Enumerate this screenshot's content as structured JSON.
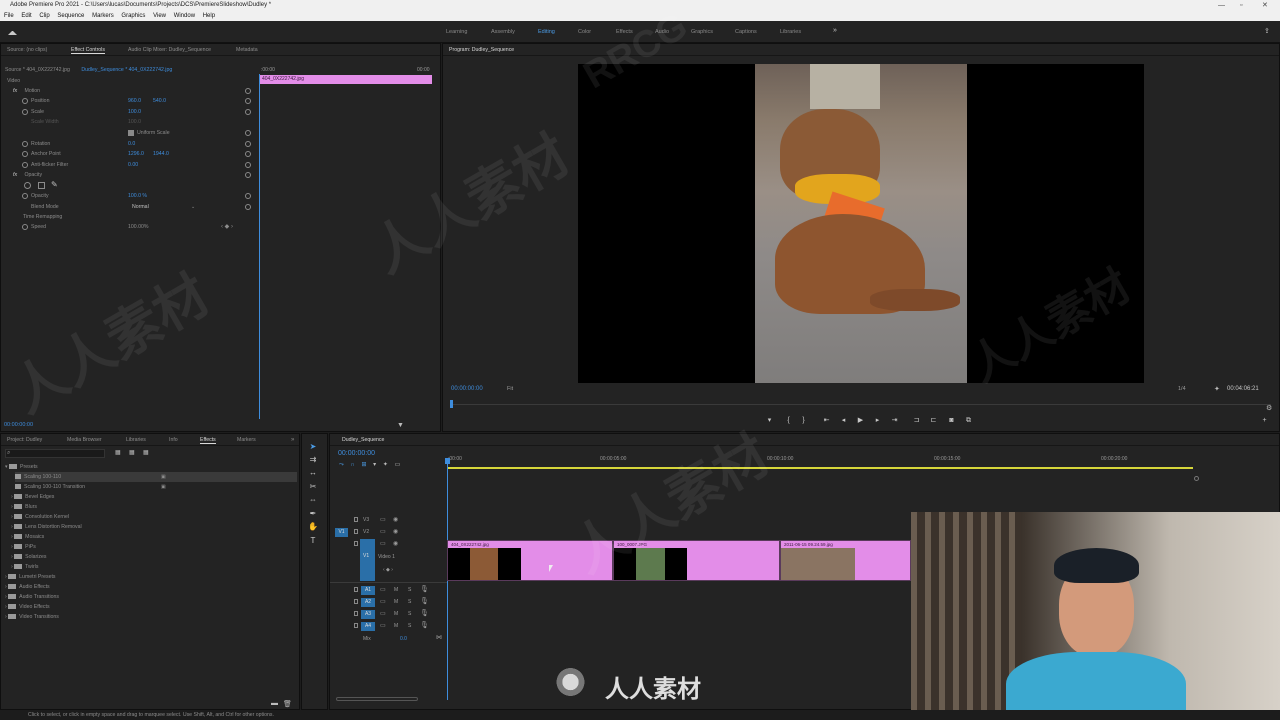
{
  "window": {
    "title": "Adobe Premiere Pro 2021 - C:\\Users\\lucas\\Documents\\Projects\\DCS\\PremiereSlideshow\\Dudley *"
  },
  "menu": [
    "File",
    "Edit",
    "Clip",
    "Sequence",
    "Markers",
    "Graphics",
    "View",
    "Window",
    "Help"
  ],
  "workspaces": [
    "Learning",
    "Assembly",
    "Editing",
    "Color",
    "Effects",
    "Audio",
    "Graphics",
    "Captions",
    "Libraries"
  ],
  "source_panel": {
    "tabs": [
      "Source: (no clips)",
      "Effect Controls",
      "Audio Clip Mixer: Dudley_Sequence",
      "Metadata"
    ],
    "clip_path": "Source * 404_0X222742.jpg",
    "sequence_path": "Dudley_Sequence * 404_0X222742.jpg",
    "ruler_start": ":00:00",
    "ruler_end": "00:00",
    "clip_bar_label": "404_0X222742.jpg",
    "section_video": "Video",
    "rows": [
      {
        "label": "Motion",
        "value": ""
      },
      {
        "label": "Position",
        "value": "960.0",
        "value2": "540.0"
      },
      {
        "label": "Scale",
        "value": "100.0"
      },
      {
        "label": "Scale Width",
        "value": "100.0"
      },
      {
        "label": "Uniform Scale",
        "value": ""
      },
      {
        "label": "Rotation",
        "value": "0.0"
      },
      {
        "label": "Anchor Point",
        "value": "1296.0",
        "value2": "1944.0"
      },
      {
        "label": "Anti-flicker Filter",
        "value": "0.00"
      },
      {
        "label": "Opacity",
        "value": ""
      },
      {
        "label": "Opacity",
        "value": "100.0 %"
      },
      {
        "label": "Blend Mode",
        "value": "Normal"
      },
      {
        "label": "Time Remapping",
        "value": ""
      },
      {
        "label": "Speed",
        "value": "100.00%"
      }
    ],
    "timecode": "00:00:00:00"
  },
  "program_monitor": {
    "title": "Program: Dudley_Sequence",
    "timecode": "00:00:00:00",
    "fit": "Fit",
    "resolution": "1/4",
    "duration": "00:04:06:21"
  },
  "project_panel": {
    "tabs": [
      "Project: Dudley",
      "Media Browser",
      "Libraries",
      "Info",
      "Effects",
      "Markers"
    ],
    "items": [
      {
        "label": "Presets",
        "level": 0
      },
      {
        "label": "Scaling 100-110",
        "level": 1
      },
      {
        "label": "Scaling 100-110 Transition",
        "level": 1
      },
      {
        "label": "Bevel Edges",
        "level": 1
      },
      {
        "label": "Blurs",
        "level": 1
      },
      {
        "label": "Convolution Kernel",
        "level": 1
      },
      {
        "label": "Lens Distortion Removal",
        "level": 1
      },
      {
        "label": "Mosaics",
        "level": 1
      },
      {
        "label": "PiPs",
        "level": 1
      },
      {
        "label": "Solarizes",
        "level": 1
      },
      {
        "label": "Twirls",
        "level": 1
      },
      {
        "label": "Lumetri Presets",
        "level": 0
      },
      {
        "label": "Audio Effects",
        "level": 0
      },
      {
        "label": "Audio Transitions",
        "level": 0
      },
      {
        "label": "Video Effects",
        "level": 0
      },
      {
        "label": "Video Transitions",
        "level": 0
      }
    ]
  },
  "timeline": {
    "sequence_tab": "Dudley_Sequence",
    "timecode": "00:00:00:00",
    "ruler": [
      ":00:00",
      "00:00:05:00",
      "00:00:10:00",
      "00:00:15:00",
      "00:00:20:00"
    ],
    "video_tracks": [
      "V3",
      "V2",
      "V1"
    ],
    "v1_name": "Video 1",
    "audio_tracks": [
      "A1",
      "A2",
      "A3",
      "A4"
    ],
    "mix_label": "Mix",
    "mix_value": "0.0",
    "clips": [
      "404_0X222742.jpg",
      "100_0007.JPG",
      "2011-06-15 09.24.59.jpg"
    ]
  },
  "status": {
    "text": "Click to select, or click in empty space and drag to marquee select. Use Shift, Alt, and Ctrl for other options."
  },
  "watermark": {
    "brand": "RRCG",
    "cn_text": "人人素材"
  },
  "colors": {
    "accent_blue": "#4b9ce6",
    "clip_pink": "#e38de8",
    "track_blue": "#2a6fa8",
    "playhead_blue": "#3e8ddd"
  }
}
